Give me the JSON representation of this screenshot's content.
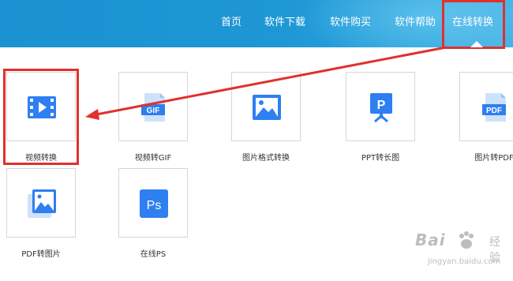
{
  "nav": {
    "items": [
      {
        "label": "首页"
      },
      {
        "label": "软件下载"
      },
      {
        "label": "软件购买"
      },
      {
        "label": "软件帮助"
      },
      {
        "label": "在线转换",
        "active": true
      }
    ]
  },
  "tools": [
    {
      "label": "视频转换",
      "icon": "video-file-icon",
      "highlighted": true
    },
    {
      "label": "视频转GIF",
      "icon": "gif-file-icon"
    },
    {
      "label": "图片格式转换",
      "icon": "image-icon"
    },
    {
      "label": "PPT转长图",
      "icon": "presentation-icon"
    },
    {
      "label": "图片转PDF",
      "icon": "pdf-file-icon"
    },
    {
      "label": "PDF转图片",
      "icon": "pdf-to-image-icon"
    },
    {
      "label": "在线PS",
      "icon": "ps-icon"
    }
  ],
  "watermark": {
    "brand": "Bai",
    "sub": "经验",
    "url": "jingyan.baidu.com"
  },
  "colors": {
    "accent": "#2e7ff0",
    "banner": "#1e97d5",
    "annotation": "#e0312d"
  }
}
